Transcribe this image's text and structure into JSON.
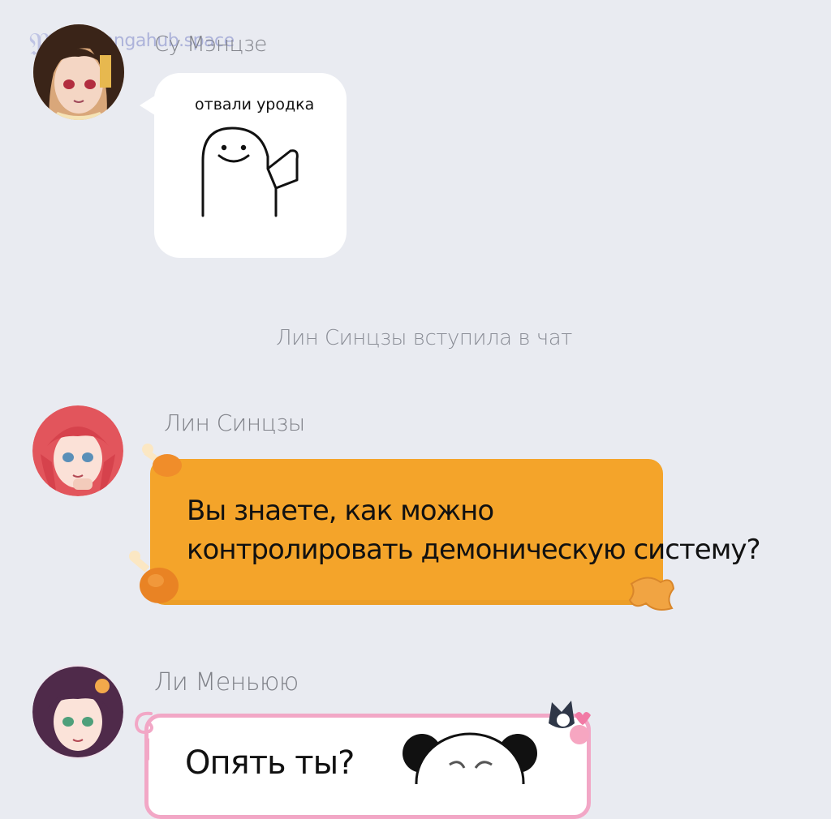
{
  "watermark": {
    "text": "mangahub.space",
    "logo": "M"
  },
  "messages": [
    {
      "sender": "Су Мэнцзе",
      "avatar": "avatar-su",
      "caption": "отвали уродка",
      "sticker": "ghost-wave-sticker"
    },
    {
      "system": "Лин Синцзы вступила в чат"
    },
    {
      "sender": "Лин Синцзы",
      "avatar": "avatar-lin",
      "lines": [
        "Вы знаете, как можно",
        "контролировать демоническую систему?"
      ],
      "bubble_color": "#f4a42a"
    },
    {
      "sender": "Ли Меньюю",
      "avatar": "avatar-li",
      "text": "Опять ты?",
      "bubble_border": "#f2a7c6",
      "sticker": "panda-face-sticker"
    }
  ],
  "colors": {
    "background": "#e9ebf1",
    "name_text": "#7f8188",
    "orange": "#f4a42a",
    "pink": "#f2a7c6"
  }
}
